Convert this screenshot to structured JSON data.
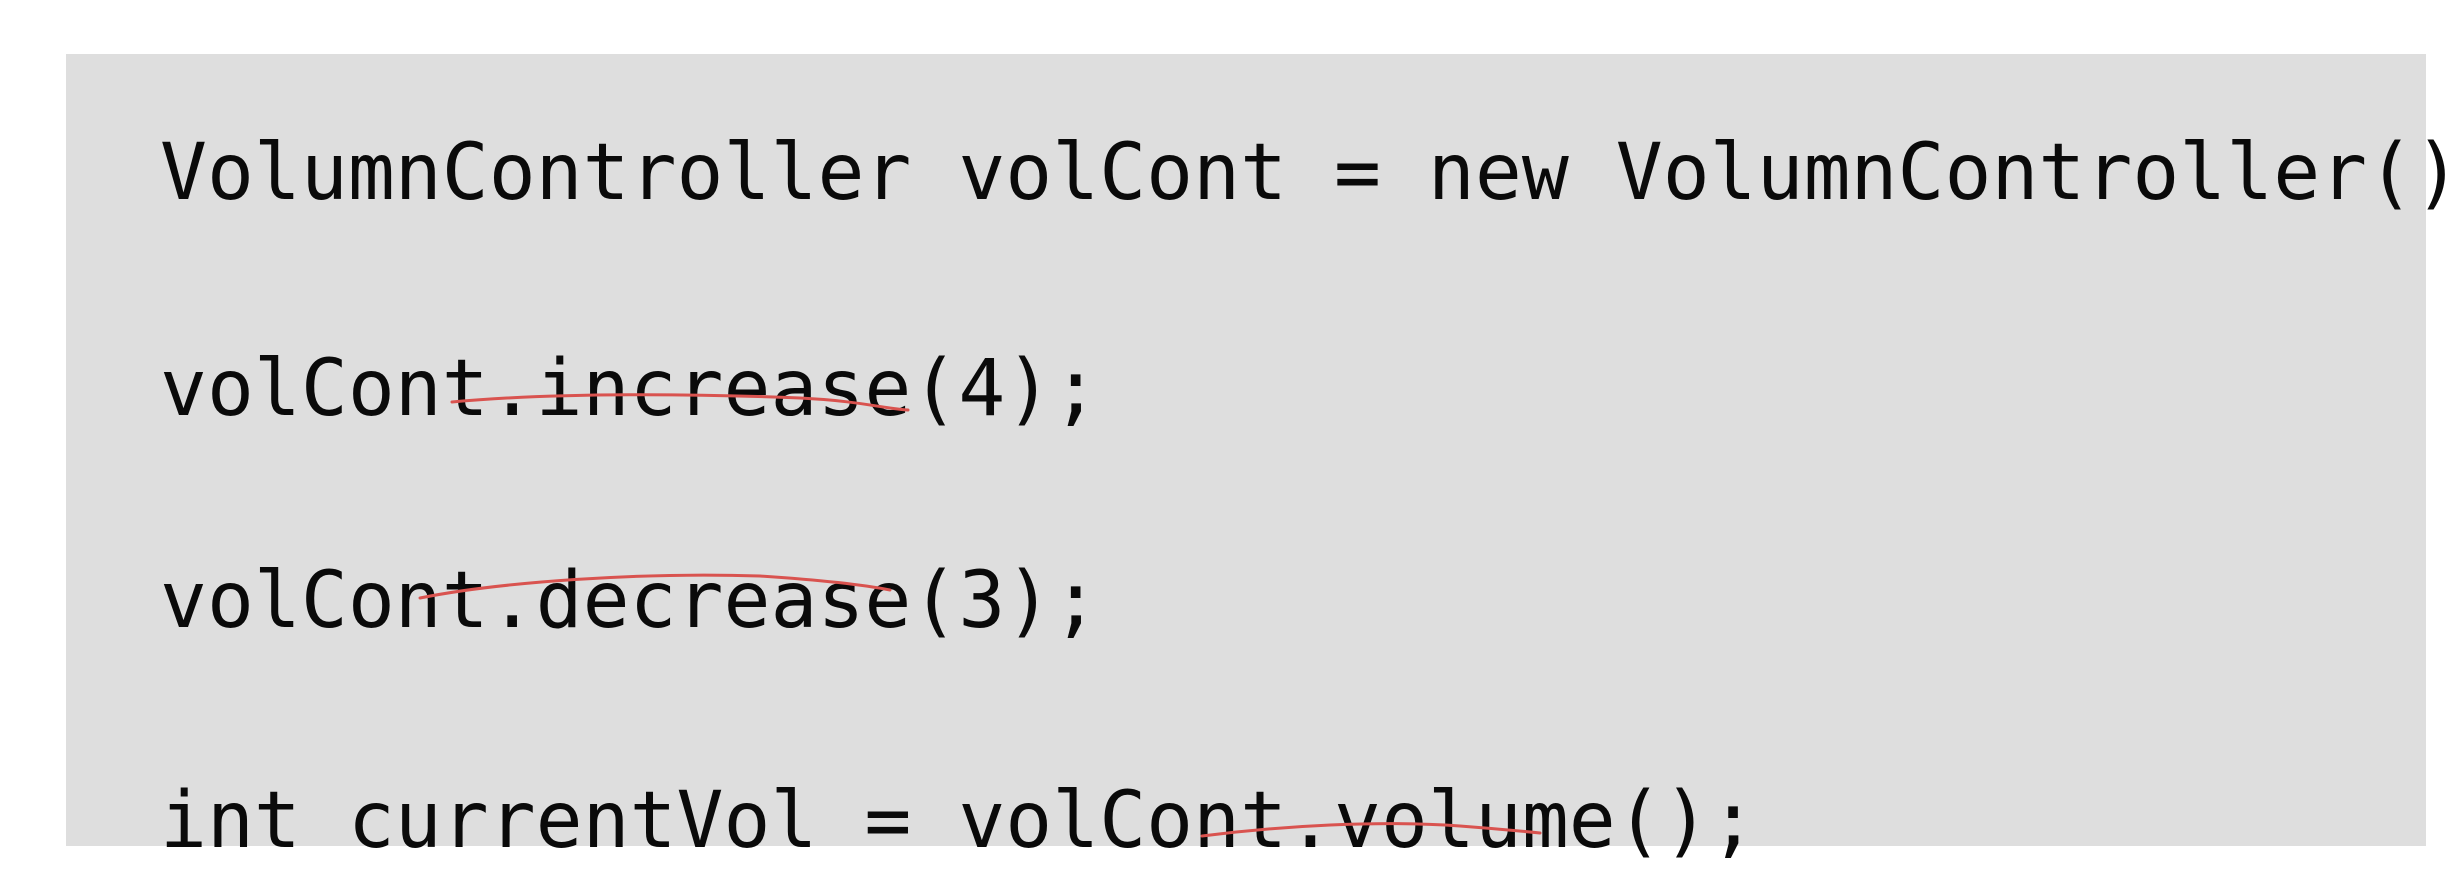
{
  "code": {
    "lines": [
      "VolumnController volCont = new VolumnController();",
      "volCont.increase(4);",
      "volCont.decrease(3);",
      "int currentVol = volCont.volume();"
    ]
  },
  "annotations": {
    "underline_color": "#d9534f",
    "underlined_calls": [
      "increase(4)",
      "decrease(3)",
      "volume()"
    ]
  },
  "colors": {
    "panel_background": "#dedede",
    "page_background": "#ffffff",
    "text": "#0a0a0a"
  }
}
